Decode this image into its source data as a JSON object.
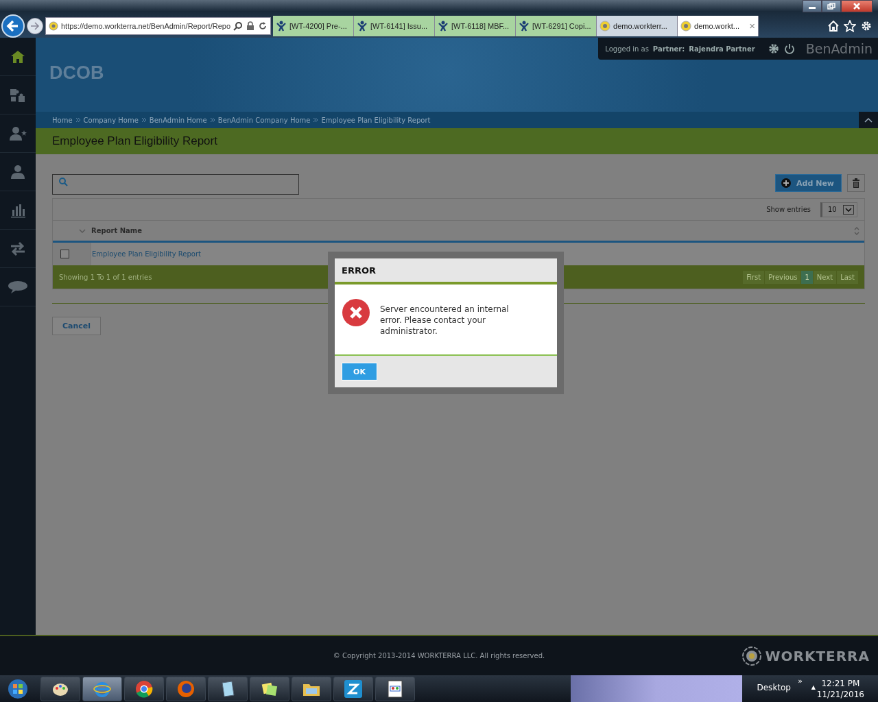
{
  "browser": {
    "address": "https://demo.workterra.net/BenAdmin/Report/Repo",
    "tabs": [
      {
        "label": "[WT-4200] Pre-...",
        "kind": "tracker",
        "selected": false
      },
      {
        "label": "[WT-6141] Issu...",
        "kind": "tracker",
        "selected": false
      },
      {
        "label": "[WT-6118] MBF...",
        "kind": "tracker",
        "selected": false
      },
      {
        "label": "[WT-6291] Copi...",
        "kind": "tracker",
        "selected": false
      },
      {
        "label": "demo.workterr...",
        "kind": "site",
        "selected": false
      },
      {
        "label": "demo.workt...",
        "kind": "site",
        "selected": true
      }
    ],
    "close_tab": "×"
  },
  "header": {
    "company": "DCOB",
    "logged_in": "Logged in as",
    "role": "Partner:",
    "user": "Rajendra Partner",
    "app": "BenAdmin"
  },
  "sidebar": [
    {
      "kind": "home",
      "selected": true
    },
    {
      "kind": "puzzle",
      "selected": false
    },
    {
      "kind": "user-star",
      "selected": false
    },
    {
      "kind": "user",
      "selected": false
    },
    {
      "kind": "chart",
      "selected": false
    },
    {
      "kind": "swap",
      "selected": false
    },
    {
      "kind": "chat",
      "selected": false
    }
  ],
  "breadcrumb": [
    "Home",
    "Company Home",
    "BenAdmin Home",
    "BenAdmin Company Home",
    "Employee Plan Eligibility Report"
  ],
  "page_title": "Employee Plan Eligibility Report",
  "add_button": "Add New",
  "table": {
    "show_entries": "Show entries",
    "page_size": "10",
    "columns": [
      "Report Name"
    ],
    "rows": [
      {
        "checked": false,
        "report_name": "Employee Plan Eligibility Report"
      }
    ],
    "info": "Showing 1 To 1 of 1 entries",
    "pages": [
      {
        "label": "First",
        "selected": false
      },
      {
        "label": "Previous",
        "selected": false
      },
      {
        "label": "1",
        "selected": true
      },
      {
        "label": "Next",
        "selected": false
      },
      {
        "label": "Last",
        "selected": false
      }
    ]
  },
  "cancel_button": "Cancel",
  "dialog": {
    "title": "ERROR",
    "message": "Server encountered an internal error. Please contact your administrator.",
    "ok": "OK"
  },
  "footer": {
    "copyright": "© Copyright 2013-2014 WORKTERRA LLC. All rights reserved.",
    "brand": "WORKTERRA"
  },
  "taskbar": {
    "apps": [
      {
        "kind": "paint",
        "active": false
      },
      {
        "kind": "ie",
        "active": true
      },
      {
        "kind": "chrome",
        "active": false
      },
      {
        "kind": "firefox",
        "active": false
      },
      {
        "kind": "notepad",
        "active": false
      },
      {
        "kind": "notes",
        "active": false
      },
      {
        "kind": "folder",
        "active": false
      },
      {
        "kind": "z",
        "active": false
      },
      {
        "kind": "doc",
        "active": false
      }
    ],
    "more": "»",
    "desktop": "Desktop",
    "tray_arrow": "▲",
    "time": "12:21 PM",
    "date": "11/21/2016"
  }
}
